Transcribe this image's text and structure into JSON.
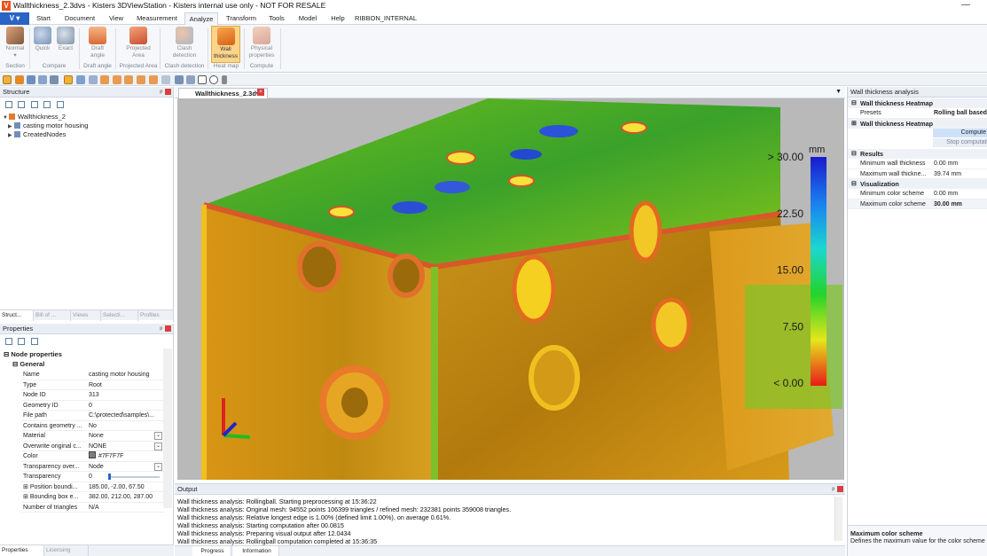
{
  "window": {
    "title": "Wallthickness_2.3dvs - Kisters 3DViewStation - Kisters internal use only - NOT FOR RESALE",
    "logo": "V",
    "min": "—"
  },
  "menu": {
    "file": "V ▾",
    "items": [
      "Start",
      "Document",
      "View",
      "Measurement",
      "Analyze",
      "Transform",
      "Tools",
      "Model",
      "Help",
      "RIBBON_INTERNAL"
    ],
    "active": "Analyze"
  },
  "ribbon": {
    "buttons": [
      {
        "label1": "Normal",
        "label2": "▾"
      },
      {
        "label1": "Quick",
        "label2": ""
      },
      {
        "label1": "Exact",
        "label2": ""
      },
      {
        "label1": "Draft",
        "label2": "angle"
      },
      {
        "label1": "Projected",
        "label2": "Area"
      },
      {
        "label1": "Clash",
        "label2": "detection"
      },
      {
        "label1": "Wall",
        "label2": "thickness"
      },
      {
        "label1": "Physical",
        "label2": "properties"
      }
    ],
    "groups": [
      "Section",
      "Compare",
      "Draft angle",
      "Projected Area",
      "Clash detection",
      "Heat map",
      "Compute"
    ]
  },
  "structure": {
    "title": "Structure",
    "pin": "ᵖ",
    "items": [
      "Wallthickness_2",
      "casting motor housing",
      "CreatedNodes"
    ],
    "tabs": [
      "Struct...",
      "Bill of ...",
      "Views",
      "Selecti...",
      "Profiles"
    ]
  },
  "properties": {
    "title": "Properties",
    "section": "Node properties",
    "subsection": "General",
    "rows": [
      {
        "k": "Name",
        "v": "casting motor housing"
      },
      {
        "k": "Type",
        "v": "Root"
      },
      {
        "k": "Node ID",
        "v": "313"
      },
      {
        "k": "Geometry ID",
        "v": "0"
      },
      {
        "k": "File path",
        "v": "C:\\protected\\samples\\..."
      },
      {
        "k": "Contains geometry ...",
        "v": "No"
      },
      {
        "k": "Material",
        "v": "None"
      },
      {
        "k": "Overwrite original c...",
        "v": "NONE"
      },
      {
        "k": "Color",
        "v": "#7F7F7F"
      },
      {
        "k": "Transparency over...",
        "v": "Node"
      },
      {
        "k": "Transparency",
        "v": "0"
      },
      {
        "k": "Position boundi...",
        "v": "185.00, -2.00, 67.50"
      },
      {
        "k": "Bounding box e...",
        "v": "382.00, 212.00, 287.00"
      },
      {
        "k": "Number of triangles",
        "v": "N/A"
      }
    ],
    "bottom_tabs": [
      "Properties",
      "Licensing"
    ]
  },
  "view": {
    "tab": "Wallthickness_2.3dvs",
    "legend": {
      "unit": "mm",
      "ticks": [
        "> 30.00",
        "22.50",
        "15.00",
        "7.50",
        "< 0.00"
      ]
    }
  },
  "output": {
    "title": "Output",
    "lines": [
      "Wall thickness analysis: Rollingball. Starting preprocessing at 15:36:22",
      "Wall thickness analysis: Original mesh: 94552 points 106399 triangles / refined mesh: 232381 points 359008 triangles.",
      "Wall thickness analysis: Relative longest edge is 1.00% (defined limit 1.00%), on average 0.61%.",
      "Wall thickness analysis: Starting computation after 00.0815",
      "Wall thickness analysis: Preparing visual output after 12.0434",
      "Wall thickness analysis: Rollingball computation completed at 15:36:35"
    ],
    "tabs": [
      "Progress",
      "Information"
    ]
  },
  "analysis": {
    "title": "Wall thickness analysis",
    "heatmap1": "Wall thickness Heatmap",
    "presets_k": "Presets",
    "presets_v": "Rolling ball based",
    "heatmap2": "Wall thickness Heatmap",
    "compute": "Compute",
    "stop": "Stop computati",
    "results": "Results",
    "min_k": "Minimum wall thickness",
    "min_v": "0.00 mm",
    "max_k": "Maximum wall thickne...",
    "max_v": "39.74 mm",
    "visualization": "Visualization",
    "minc_k": "Minimum color scheme",
    "minc_v": "0.00 mm",
    "maxc_k": "Maximum color scheme",
    "maxc_v": "30.00 mm",
    "help_title": "Maximum color scheme",
    "help_text": "Defines the maximum value for the color scheme"
  }
}
